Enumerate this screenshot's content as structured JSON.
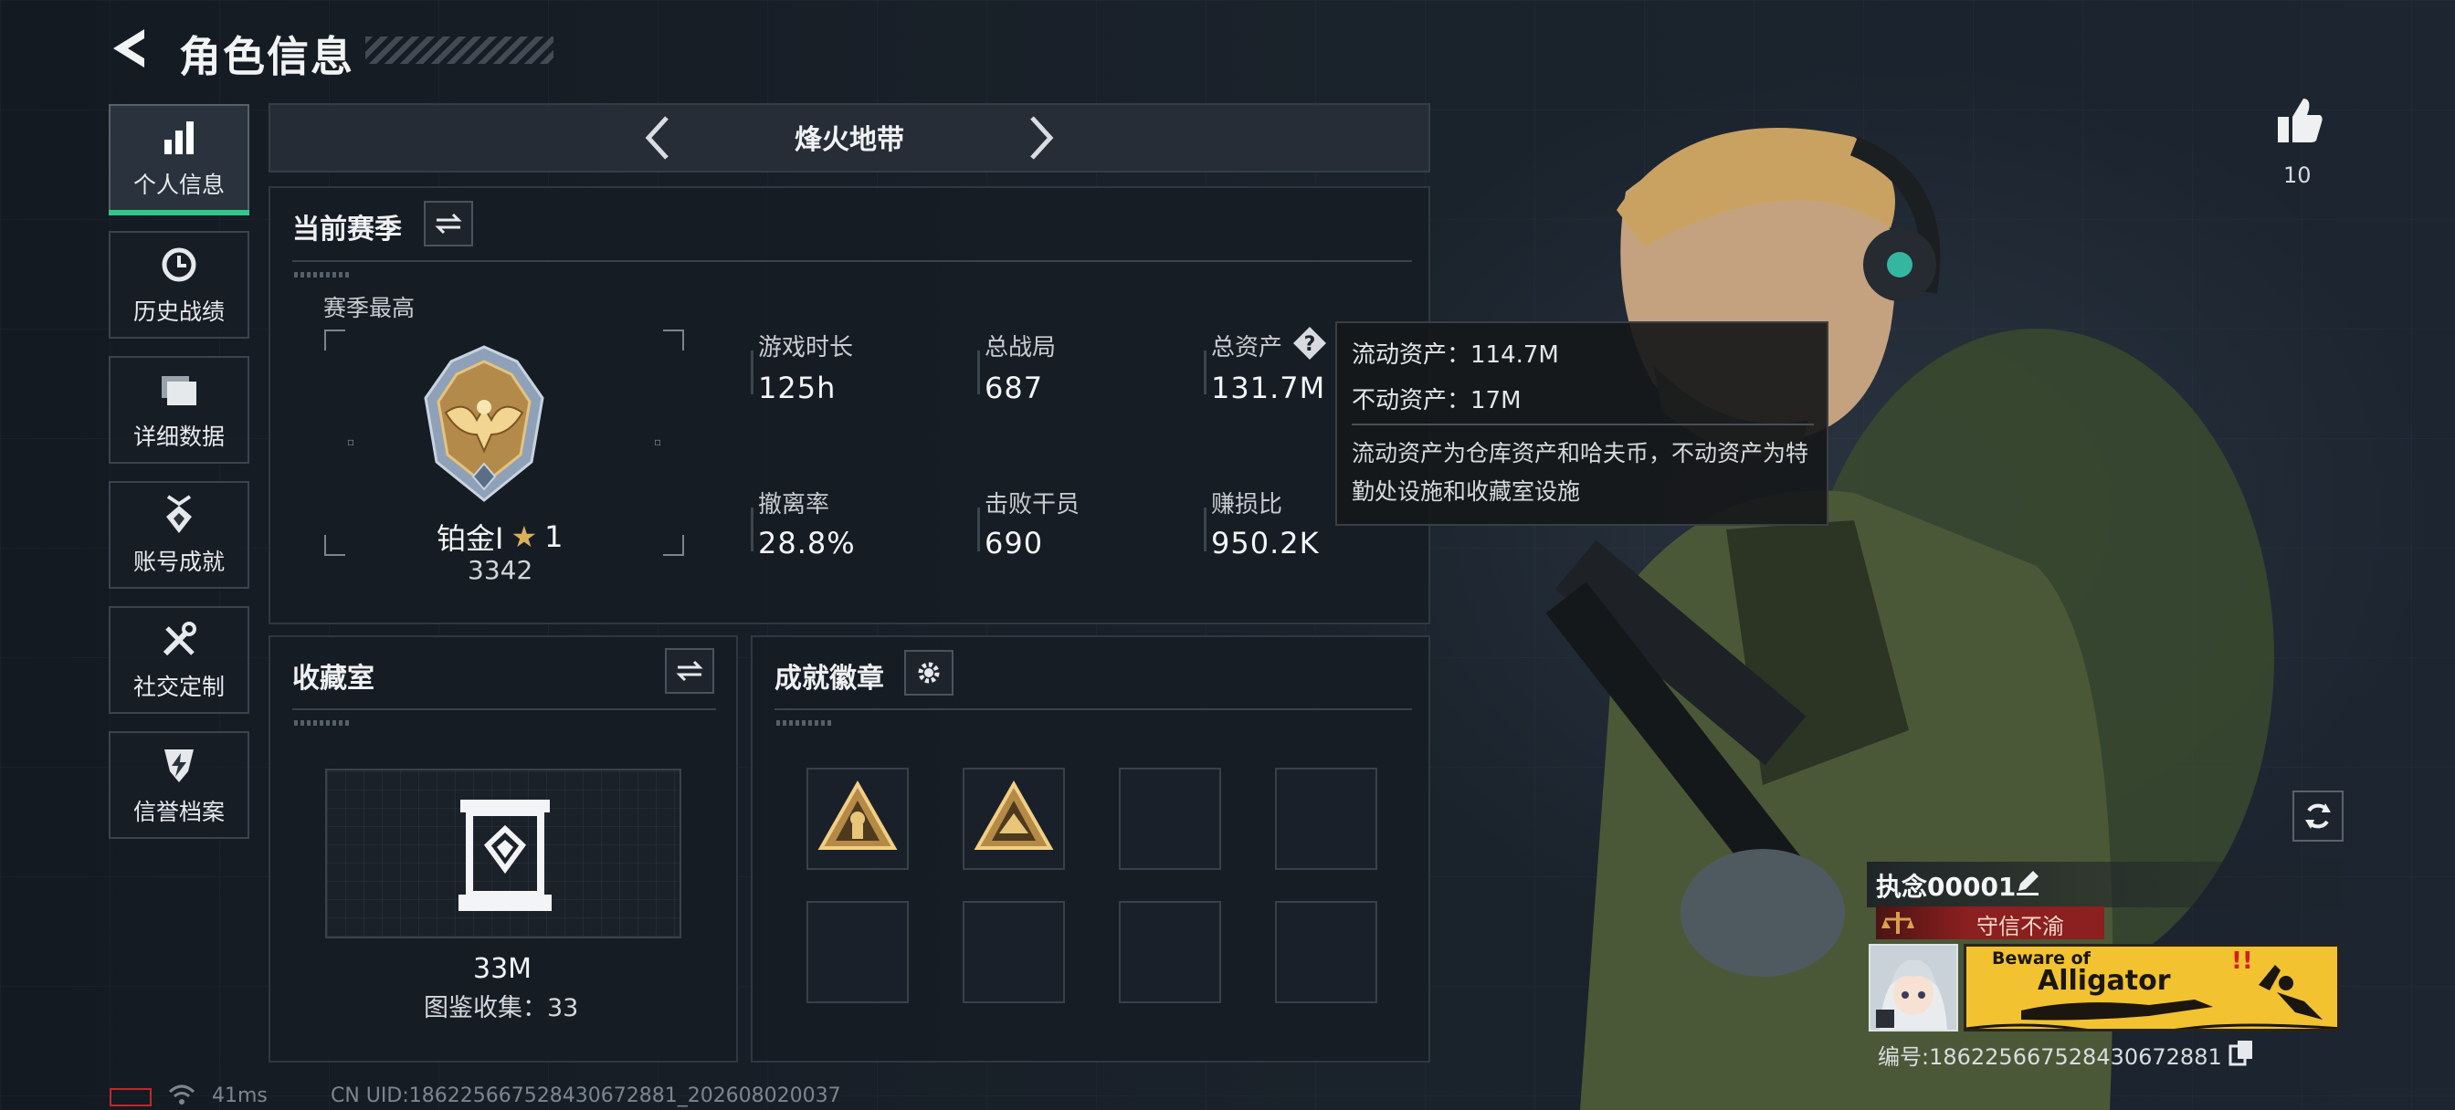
{
  "header": {
    "title": "角色信息"
  },
  "sidebar": {
    "items": [
      {
        "label": "个人信息",
        "icon": "bar-chart-icon",
        "active": true
      },
      {
        "label": "历史战绩",
        "icon": "history-clock-icon",
        "active": false
      },
      {
        "label": "详细数据",
        "icon": "folder-icon",
        "active": false
      },
      {
        "label": "账号成就",
        "icon": "achievement-medal-icon",
        "active": false
      },
      {
        "label": "社交定制",
        "icon": "tools-icon",
        "active": false
      },
      {
        "label": "信誉档案",
        "icon": "shield-bolt-icon",
        "active": false
      }
    ]
  },
  "mode_selector": {
    "title": "烽火地带"
  },
  "season": {
    "title": "当前赛季",
    "best_label": "赛季最高",
    "rank_name": "铂金Ⅰ",
    "rank_stars": "1",
    "rank_score": "3342",
    "stats": [
      {
        "label": "游戏时长",
        "value": "125h"
      },
      {
        "label": "总战局",
        "value": "687"
      },
      {
        "label": "总资产",
        "value": "131.7M"
      },
      {
        "label": "撤离率",
        "value": "28.8%"
      },
      {
        "label": "击败干员",
        "value": "690"
      },
      {
        "label": "赚损比",
        "value": "950.2K"
      }
    ]
  },
  "tooltip": {
    "liquid": "流动资产：114.7M",
    "fixed": "不动资产：17M",
    "description": "流动资产为仓库资产和哈夫币，不动资产为特勤处设施和收藏室设施"
  },
  "collection": {
    "title": "收藏室",
    "value": "33M",
    "catalog": "图鉴收集：33"
  },
  "badges": {
    "title": "成就徽章",
    "slots": [
      true,
      true,
      false,
      false,
      false,
      false,
      false,
      false
    ]
  },
  "likes": {
    "count": "10"
  },
  "player": {
    "name": "执念00001",
    "title": "守信不渝",
    "banner_line1": "Beware of",
    "banner_line2": "Alligator",
    "uid_label": "编号:1862256675284306728​81"
  },
  "footer": {
    "ping": "41ms",
    "uid": "CN UID:18622566752843067288​1_202608020037"
  },
  "colors": {
    "accent": "#2fc889",
    "title_bar": "#8c1f1f",
    "banner": "#f2c230"
  }
}
